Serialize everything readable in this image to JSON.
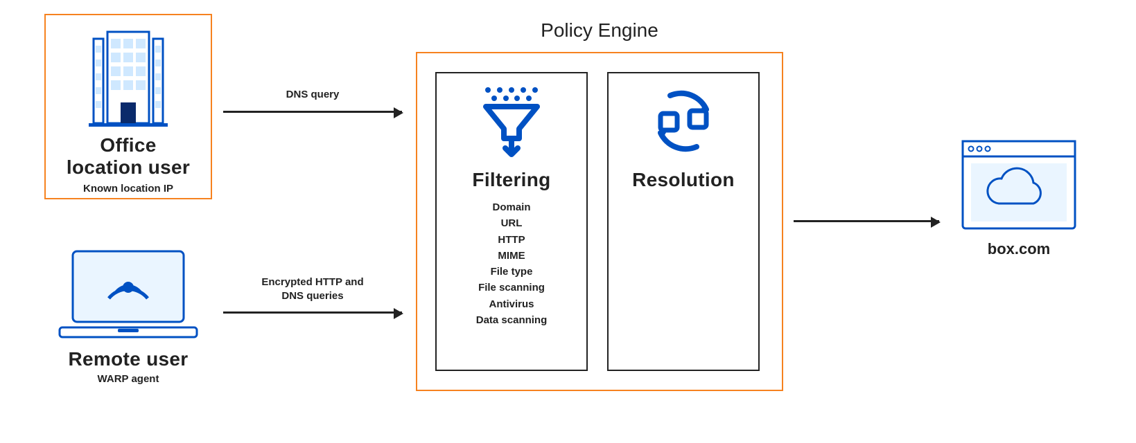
{
  "office": {
    "title1": "Office",
    "title2": "location user",
    "subtitle": "Known location IP"
  },
  "remote": {
    "title": "Remote user",
    "subtitle": "WARP agent"
  },
  "arrows": {
    "dns": "DNS query",
    "enc1": "Encrypted HTTP and",
    "enc2": "DNS queries"
  },
  "policy_engine": {
    "title": "Policy Engine",
    "filtering": {
      "title": "Filtering",
      "items": [
        "Domain",
        "URL",
        "HTTP",
        "MIME",
        "File type",
        "File scanning",
        "Antivirus",
        "Data scanning"
      ]
    },
    "resolution": {
      "title": "Resolution"
    }
  },
  "destination": {
    "label": "box.com"
  },
  "colors": {
    "accent_orange": "#f6821f",
    "brand_blue": "#0051c3",
    "light_blue": "#e8f4ff"
  }
}
